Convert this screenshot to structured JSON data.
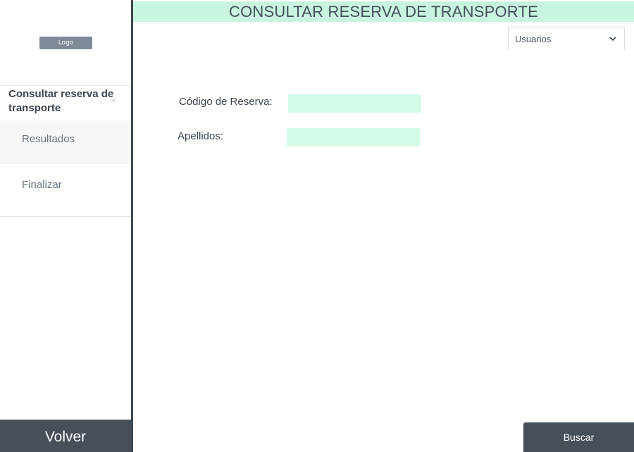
{
  "sidebar": {
    "logo_text": "Logo",
    "section_title": "Consultar reserva de transporte",
    "items": [
      {
        "label": "Resultados"
      },
      {
        "label": "Finalizar"
      }
    ],
    "back_button": "Volver"
  },
  "header": {
    "title": "CONSULTAR RESERVA DE TRANSPORTE",
    "user_menu": "Usuarios"
  },
  "form": {
    "codigo_label": "Código de Reserva:",
    "codigo_value": "",
    "apellidos_label": "Apellidos:",
    "apellidos_value": "",
    "search_button": "Buscar"
  },
  "colors": {
    "accent_green": "#c8f5df",
    "input_green": "#d4fbe8",
    "dark_button": "#474f59"
  }
}
